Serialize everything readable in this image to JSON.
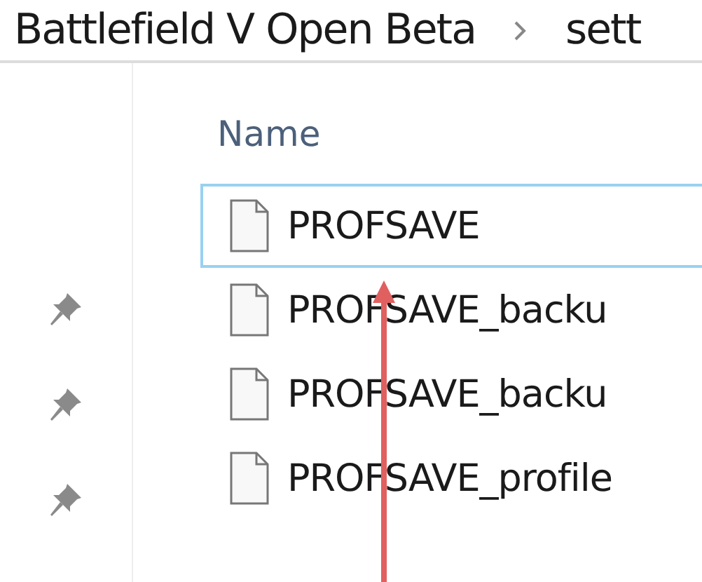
{
  "breadcrumb": [
    {
      "label": "Battlefield V Open Beta"
    },
    {
      "label": "sett"
    }
  ],
  "quick_access": [
    {
      "pinned": true
    },
    {
      "pinned": true
    },
    {
      "pinned": true
    }
  ],
  "columns": [
    {
      "label": "Name"
    }
  ],
  "files": [
    {
      "name": "PROFSAVE",
      "selected": true
    },
    {
      "name": "PROFSAVE_backu",
      "selected": false
    },
    {
      "name": "PROFSAVE_backu",
      "selected": false
    },
    {
      "name": "PROFSAVE_profile",
      "selected": false
    }
  ]
}
